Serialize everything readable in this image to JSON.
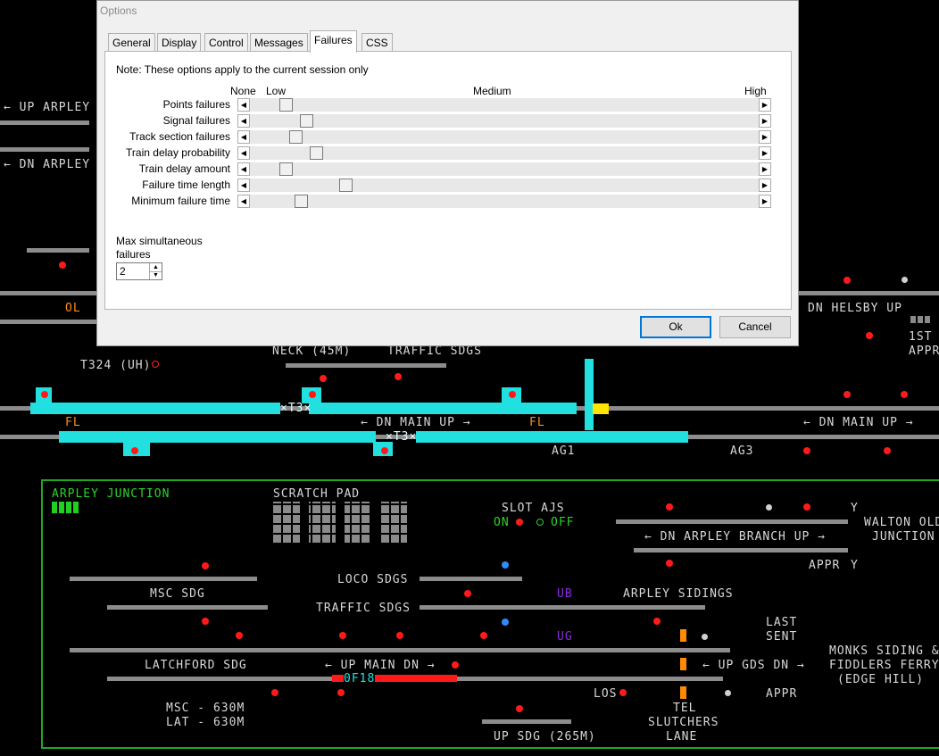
{
  "dialog": {
    "title": "Options",
    "tabs": [
      "General",
      "Display",
      "Control",
      "Messages",
      "Failures",
      "CSS"
    ],
    "active_tab": "Failures",
    "note": "Note: These options apply to the current session only",
    "scale": {
      "none": "None",
      "low": "Low",
      "medium": "Medium",
      "high": "High"
    },
    "sliders": [
      {
        "label": "Points failures",
        "value": 0.06
      },
      {
        "label": "Signal failures",
        "value": 0.1
      },
      {
        "label": "Track section failures",
        "value": 0.08
      },
      {
        "label": "Train delay probability",
        "value": 0.12
      },
      {
        "label": "Train delay amount",
        "value": 0.06
      },
      {
        "label": "Failure time length",
        "value": 0.18
      },
      {
        "label": "Minimum failure time",
        "value": 0.09
      }
    ],
    "max_failures_label": "Max simultaneous failures",
    "max_failures_value": "2",
    "ok": "Ok",
    "cancel": "Cancel"
  },
  "panel": {
    "up_arpley": "← UP ARPLEY",
    "dn_arpley": "← DN ARPLEY",
    "ol": "OL",
    "t324": "T324 (UH)",
    "neck": "NECK (45M)",
    "traffic_sdgs_top": "TRAFFIC SDGS",
    "dn_main_up_1": "← DN MAIN UP →",
    "dn_main_up_2": "← DN MAIN UP →",
    "fl1": "FL",
    "fl2": "FL",
    "t3_1": "×T3×",
    "t3_2": "×T3×",
    "ag1": "AG1",
    "ag3": "AG3",
    "dn_helsby_up": "DN HELSBY UP",
    "first_appr": "1ST",
    "appr_top": "APPR",
    "box_name": "ARPLEY JUNCTION",
    "scratch_pad": "SCRATCH PAD",
    "slot_ajs": "SLOT AJS",
    "slot_on": "ON",
    "slot_off": "OFF",
    "dn_arpley_branch_up": "← DN ARPLEY BRANCH UP →",
    "walton_old_1": "WALTON OLD",
    "walton_old_2": "JUNCTION",
    "appr_right": "APPR",
    "y1": "Y",
    "y2": "Y",
    "msc_sdg": "MSC SDG",
    "loco_sdgs": "LOCO SDGS",
    "traffic_sdgs": "TRAFFIC SDGS",
    "ub": "UB",
    "ug": "UG",
    "arpley_sidings": "ARPLEY SIDINGS",
    "last_sent_1": "LAST",
    "last_sent_2": "SENT",
    "latchford_sdg": "LATCHFORD SDG",
    "up_main_dn": "← UP MAIN DN →",
    "train_id": "0F18",
    "up_gds_dn": "← UP GDS DN →",
    "monks_1": "MONKS SIDING &",
    "monks_2": "FIDDLERS FERRY",
    "monks_3": "(EDGE HILL)",
    "appr_bottom": "APPR",
    "los": "LOS",
    "msc_time": "MSC - 630M",
    "lat_time": "LAT - 630M",
    "tel": "TEL",
    "slutchers_1": "SLUTCHERS",
    "slutchers_2": "LANE",
    "up_sdg": "UP SDG (265M)",
    "colors": {
      "track": "#8c8c8c",
      "route": "#22e0e0",
      "box_border": "#1fa81f",
      "signal_red": "#ff1a1a",
      "occupied": "#ff1a1a",
      "label": "#d8d8d8",
      "fringe": "#ff8c00"
    }
  }
}
